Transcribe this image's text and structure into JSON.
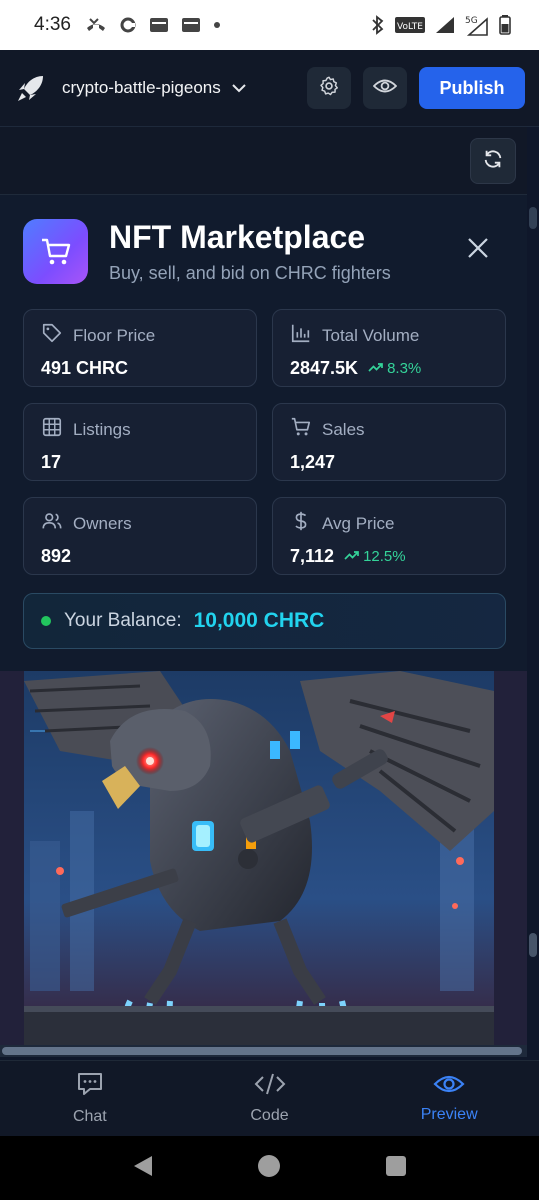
{
  "status_bar": {
    "time": "4:36",
    "network_label": "5G",
    "volte_label": "VoLTE"
  },
  "header": {
    "project_name": "crypto-battle-pigeons",
    "publish_label": "Publish"
  },
  "modal": {
    "title": "NFT Marketplace",
    "subtitle": "Buy, sell, and bid on CHRC fighters",
    "stats": [
      {
        "label": "Floor Price",
        "value": "491 CHRC",
        "icon": "tag-icon"
      },
      {
        "label": "Total Volume",
        "value": "2847.5K",
        "change": "8.3%",
        "icon": "bar-chart-icon"
      },
      {
        "label": "Listings",
        "value": "17",
        "icon": "grid-icon"
      },
      {
        "label": "Sales",
        "value": "1,247",
        "icon": "cart-icon"
      },
      {
        "label": "Owners",
        "value": "892",
        "icon": "users-icon"
      },
      {
        "label": "Avg Price",
        "value": "7,112",
        "change": "12.5%",
        "icon": "dollar-icon"
      }
    ],
    "balance_label": "Your Balance:",
    "balance_value": "10,000 CHRC"
  },
  "bottom_nav": [
    {
      "label": "Chat",
      "icon": "chat-icon",
      "active": false
    },
    {
      "label": "Code",
      "icon": "code-icon",
      "active": false
    },
    {
      "label": "Preview",
      "icon": "eye-icon",
      "active": true
    }
  ],
  "colors": {
    "accent": "#2563eb",
    "positive": "#34d399",
    "balance": "#22d3ee",
    "active_nav": "#3b82f6"
  }
}
